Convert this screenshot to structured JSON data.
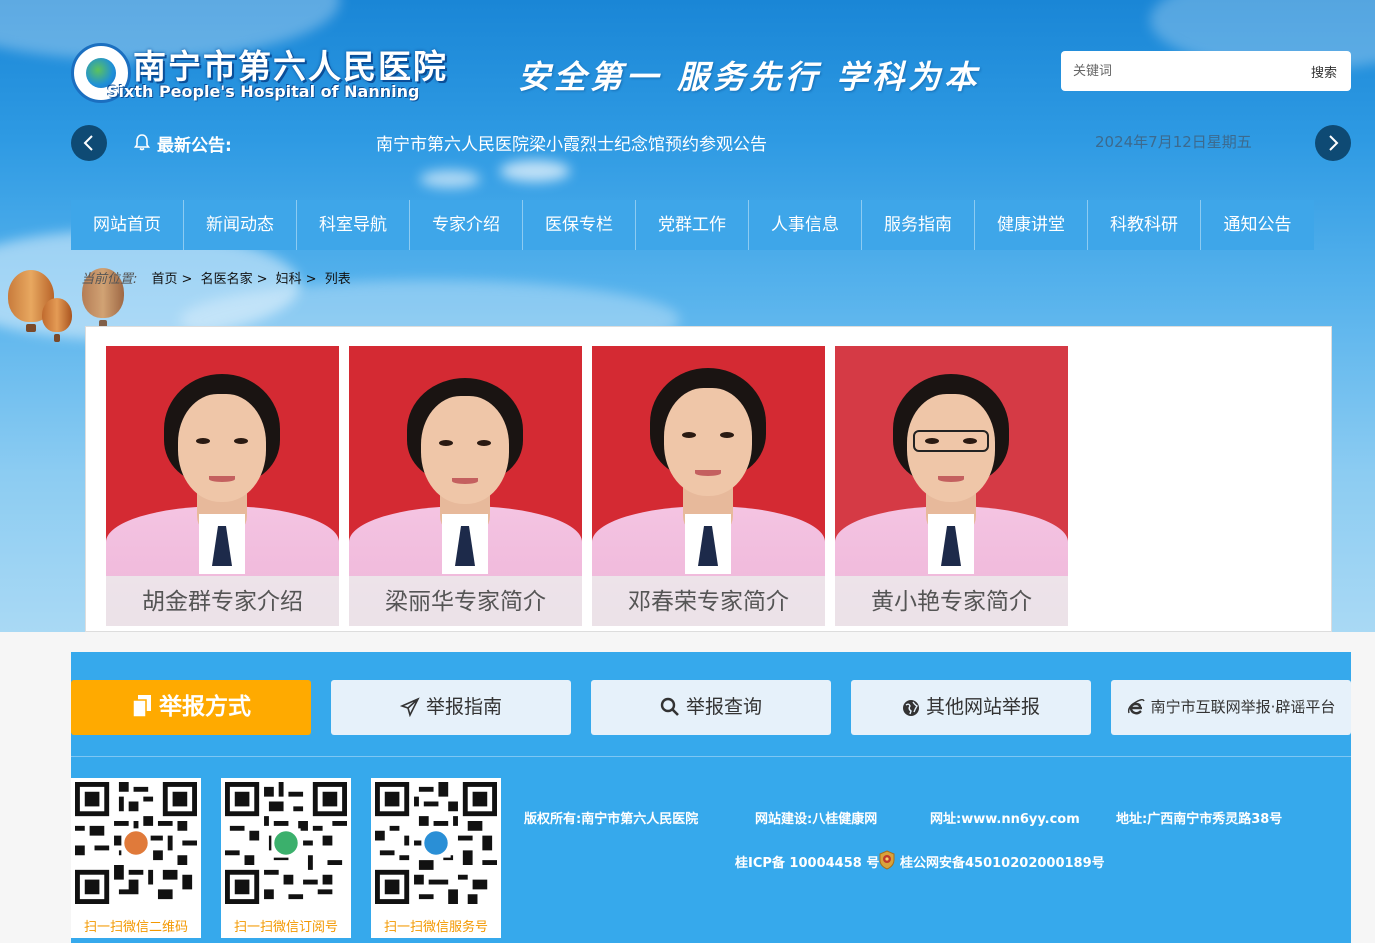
{
  "header": {
    "logo_cn": "南宁市第六人民医院",
    "logo_en": "Sixth People's Hospital of Nanning",
    "slogan": "安全第一  服务先行  学科为本",
    "search_placeholder": "关键词",
    "search_button": "搜索"
  },
  "notice": {
    "label": "最新公告:",
    "text": "南宁市第六人民医院梁小霞烈士纪念馆预约参观公告",
    "date": "2024年7月12日星期五"
  },
  "nav": [
    "网站首页",
    "新闻动态",
    "科室导航",
    "专家介绍",
    "医保专栏",
    "党群工作",
    "人事信息",
    "服务指南",
    "健康讲堂",
    "科教科研",
    "通知公告"
  ],
  "breadcrumb": {
    "label": "当前位置:",
    "items": [
      "首页",
      "名医名家",
      "妇科",
      "列表"
    ]
  },
  "doctors": [
    {
      "caption": "胡金群专家介绍"
    },
    {
      "caption": "梁丽华专家简介"
    },
    {
      "caption": "邓春荣专家简介"
    },
    {
      "caption": "黄小艳专家简介"
    }
  ],
  "report": {
    "primary": "举报方式",
    "guide": "举报指南",
    "query": "举报查询",
    "other": "其他网站举报",
    "platform": "南宁市互联网举报·辟谣平台"
  },
  "qrcodes": [
    {
      "caption": "扫一扫微信二维码"
    },
    {
      "caption": "扫一扫微信订阅号"
    },
    {
      "caption": "扫一扫微信服务号"
    }
  ],
  "footer": {
    "copyright": "版权所有:南宁市第六人民医院",
    "builder": "网站建设:八桂健康网",
    "website": "网址:www.nn6yy.com",
    "address": "地址:广西南宁市秀灵路38号",
    "icp": "桂ICP备 10004458 号",
    "police": "桂公网安备45010202000189号"
  },
  "colors": {
    "nav_bg": "#3ea6e9",
    "footer_bg": "#36a9ec",
    "primary_button": "#ffaa00",
    "qr_caption": "#f39800"
  }
}
